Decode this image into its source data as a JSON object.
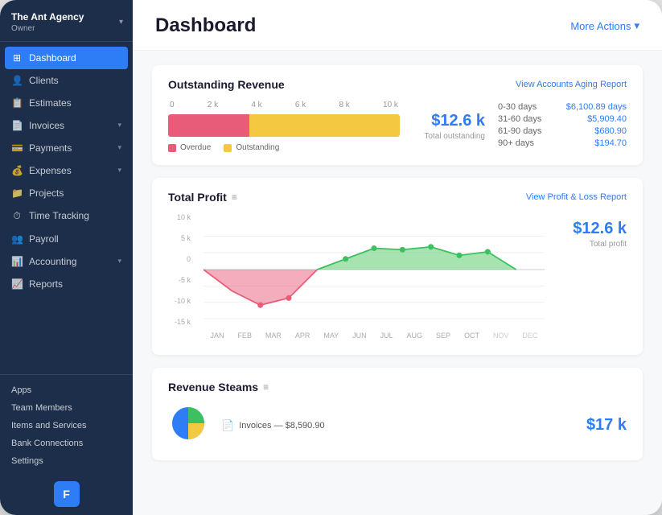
{
  "agency": {
    "name": "The Ant Agency",
    "role": "Owner",
    "chevron": "▾"
  },
  "sidebar": {
    "items": [
      {
        "id": "dashboard",
        "label": "Dashboard",
        "icon": "⊞",
        "active": true,
        "hasArrow": false
      },
      {
        "id": "clients",
        "label": "Clients",
        "icon": "👤",
        "active": false,
        "hasArrow": false
      },
      {
        "id": "estimates",
        "label": "Estimates",
        "icon": "📋",
        "active": false,
        "hasArrow": false
      },
      {
        "id": "invoices",
        "label": "Invoices",
        "icon": "📄",
        "active": false,
        "hasArrow": true
      },
      {
        "id": "payments",
        "label": "Payments",
        "icon": "💳",
        "active": false,
        "hasArrow": true
      },
      {
        "id": "expenses",
        "label": "Expenses",
        "icon": "💰",
        "active": false,
        "hasArrow": true
      },
      {
        "id": "projects",
        "label": "Projects",
        "icon": "📁",
        "active": false,
        "hasArrow": false
      },
      {
        "id": "time-tracking",
        "label": "Time Tracking",
        "icon": "⏱",
        "active": false,
        "hasArrow": false
      },
      {
        "id": "payroll",
        "label": "Payroll",
        "icon": "👥",
        "active": false,
        "hasArrow": false
      },
      {
        "id": "accounting",
        "label": "Accounting",
        "icon": "📊",
        "active": false,
        "hasArrow": true
      },
      {
        "id": "reports",
        "label": "Reports",
        "icon": "📈",
        "active": false,
        "hasArrow": false
      }
    ],
    "secondary": [
      {
        "id": "apps",
        "label": "Apps"
      },
      {
        "id": "team-members",
        "label": "Team Members"
      },
      {
        "id": "items-services",
        "label": "Items and Services"
      },
      {
        "id": "bank-connections",
        "label": "Bank Connections"
      },
      {
        "id": "settings",
        "label": "Settings"
      }
    ]
  },
  "header": {
    "title": "Dashboard",
    "more_actions_label": "More Actions",
    "more_actions_chevron": "▾"
  },
  "outstanding_revenue": {
    "title": "Outstanding Revenue",
    "view_link": "View Accounts Aging Report",
    "total_amount": "$12.6 k",
    "total_label": "Total outstanding",
    "axis_labels": [
      "0",
      "2 k",
      "4 k",
      "6 k",
      "8 k",
      "10 k"
    ],
    "bar_overdue_pct": 35,
    "bar_outstanding_pct": 65,
    "legend": [
      {
        "label": "Overdue",
        "color": "#e85c7a"
      },
      {
        "label": "Outstanding",
        "color": "#f5c842"
      }
    ],
    "aging": [
      {
        "period": "0-30 days",
        "amount": "$6,100.89 days"
      },
      {
        "period": "31-60 days",
        "amount": "$5,909.40"
      },
      {
        "period": "61-90 days",
        "amount": "$680.90"
      },
      {
        "period": "90+ days",
        "amount": "$194.70"
      }
    ]
  },
  "total_profit": {
    "title": "Total Profit",
    "view_link": "View Profit & Loss Report",
    "total_amount": "$12.6 k",
    "total_label": "Total profit",
    "y_labels": [
      "10 k",
      "5 k",
      "0",
      "-5 k",
      "-10 k",
      "-15 k"
    ],
    "x_labels": [
      "JAN",
      "FEB",
      "MAR",
      "APR",
      "MAY",
      "JUN",
      "JUL",
      "AUG",
      "SEP",
      "OCT",
      "NOV",
      "DEC"
    ]
  },
  "revenue_steams": {
    "title": "Revenue Steams",
    "view_link": "",
    "invoice_icon": "📄",
    "invoice_label": "Invoices — $8,590.90",
    "total_amount": "$17 k"
  },
  "freshbooks_logo": "F"
}
